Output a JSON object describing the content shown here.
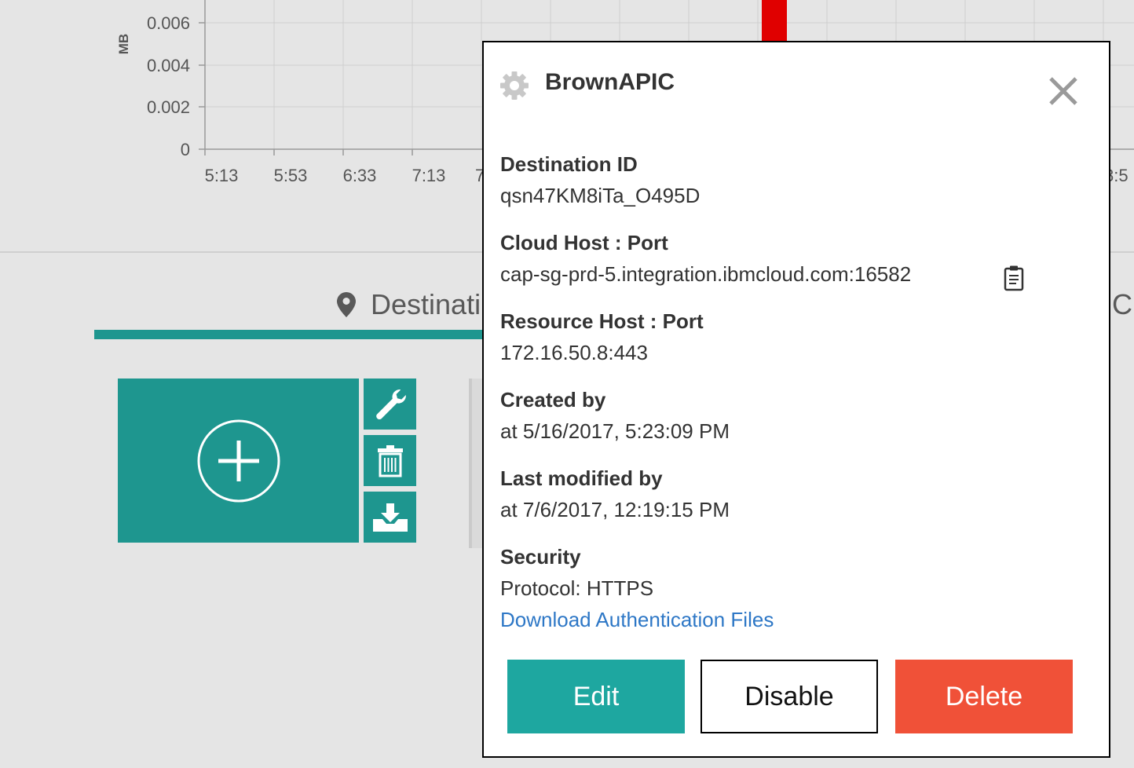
{
  "chart": {
    "unit_label": "MB",
    "y_ticks": [
      "0.006",
      "0.004",
      "0.002",
      "0"
    ],
    "x_ticks": [
      "5:13",
      "5:53",
      "6:33",
      "7:13"
    ],
    "x_tick_partial_left": "7",
    "x_tick_partial_right": "8:5"
  },
  "tabs": {
    "destinations_label": "Destinati",
    "right_fragment": "C"
  },
  "popup": {
    "title": "BrownAPIC",
    "destination_id_label": "Destination ID",
    "destination_id": "qsn47KM8iTa_O495D",
    "cloud_host_label": "Cloud Host : Port",
    "cloud_host": "cap-sg-prd-5.integration.ibmcloud.com:16582",
    "resource_host_label": "Resource Host : Port",
    "resource_host": "172.16.50.8:443",
    "created_by_label": "Created by",
    "created_at": "at 5/16/2017, 5:23:09 PM",
    "modified_by_label": "Last modified by",
    "modified_at": "at 7/6/2017, 12:19:15 PM",
    "security_label": "Security",
    "protocol": "Protocol: HTTPS",
    "download_link": "Download Authentication Files",
    "edit_label": "Edit",
    "disable_label": "Disable",
    "delete_label": "Delete"
  },
  "colors": {
    "accent": "#1e968f",
    "edit": "#1ea7a0",
    "delete": "#f05138",
    "link": "#2d77c6",
    "marker": "#e00000"
  },
  "icons": {
    "tab": "map-pin-icon",
    "add": "plus-circle-icon",
    "configure": "wrench-icon",
    "remove": "trash-icon",
    "download": "download-tray-icon",
    "popup": "gear-icon",
    "close": "close-icon",
    "copy": "clipboard-icon"
  }
}
